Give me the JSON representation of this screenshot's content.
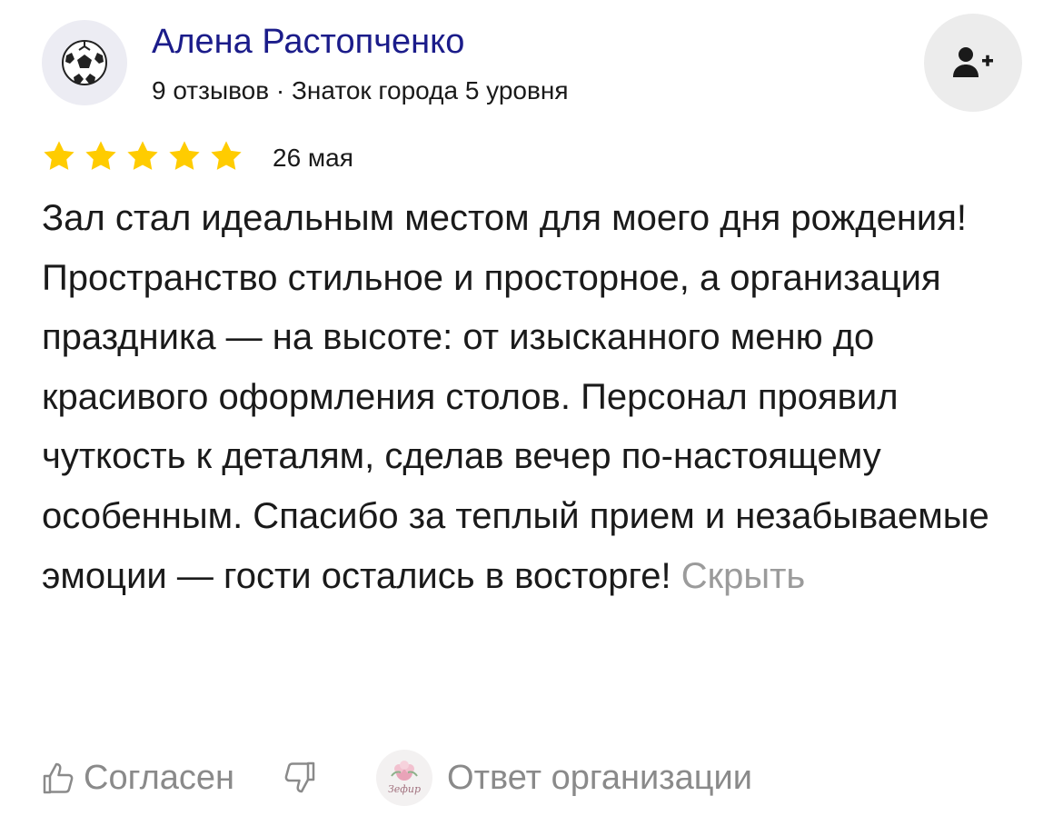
{
  "author": {
    "name": "Алена Растопченко",
    "meta": "9 отзывов · Знаток города 5 уровня",
    "avatar_icon": "soccer-ball-icon"
  },
  "subscribe": {
    "icon": "person-add-icon"
  },
  "rating": {
    "stars": 5,
    "max": 5,
    "color": "#ffcc00"
  },
  "review": {
    "date": "26 мая",
    "text": "Зал стал идеальным местом для моего дня рождения! Пространство стильное и просторное, а организация праздника — на высоте: от изысканного меню до красивого оформления столов. Персонал проявил чуткость к деталям, сделав вечер по-настоящему особенным. Спасибо за теплый прием и незабываемые эмоции — гости остались в восторге!",
    "hide_label": "Скрыть"
  },
  "actions": {
    "like_label": "Согласен",
    "org_reply_label": "Ответ организации",
    "org_logo_text": "Зефир"
  },
  "colors": {
    "name": "#1b1c8a",
    "muted": "#8a8a8a",
    "text": "#1a1a1a"
  }
}
